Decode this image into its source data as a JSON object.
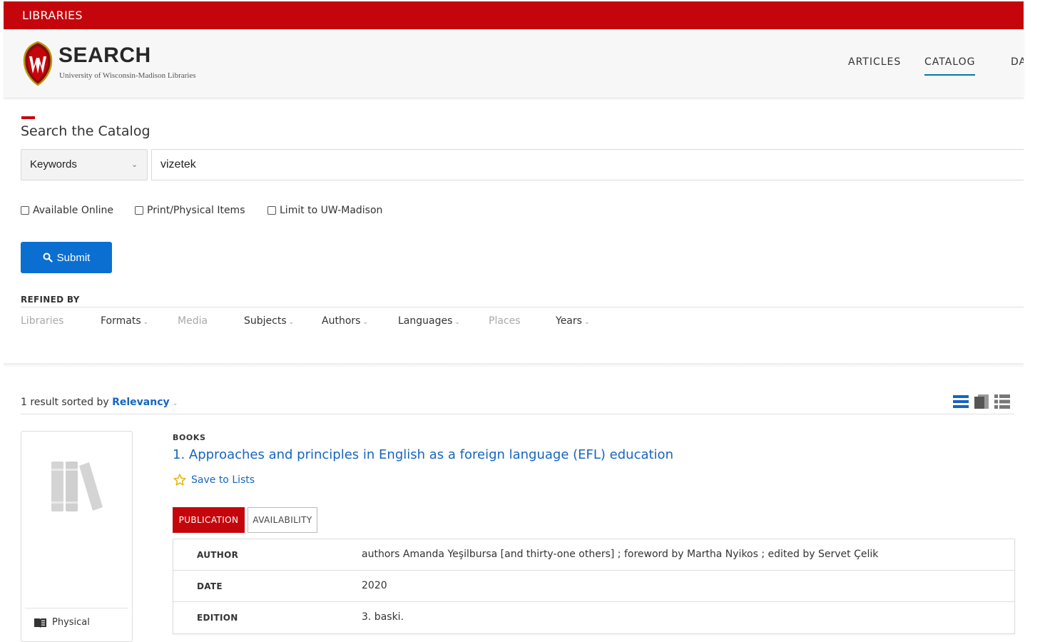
{
  "topbar": {
    "label": "LIBRARIES"
  },
  "brand": {
    "title": "SEARCH",
    "subtitle": "University of Wisconsin-Madison Libraries"
  },
  "nav": {
    "items": [
      "ARTICLES",
      "CATALOG",
      "DA"
    ],
    "active": "CATALOG"
  },
  "search": {
    "title": "Search the Catalog",
    "field_select": "Keywords",
    "query": "vizetek",
    "checkboxes": [
      "Available Online",
      "Print/Physical Items",
      "Limit to UW-Madison"
    ],
    "submit_label": "Submit"
  },
  "refined": {
    "heading": "REFINED BY",
    "facets": [
      {
        "label": "Libraries",
        "enabled": false
      },
      {
        "label": "Formats",
        "enabled": true
      },
      {
        "label": "Media",
        "enabled": false
      },
      {
        "label": "Subjects",
        "enabled": true
      },
      {
        "label": "Authors",
        "enabled": true
      },
      {
        "label": "Languages",
        "enabled": true
      },
      {
        "label": "Places",
        "enabled": false
      },
      {
        "label": "Years",
        "enabled": true
      }
    ]
  },
  "results": {
    "count_text": "1 result sorted by",
    "sort": "Relevancy"
  },
  "record": {
    "type": "BOOKS",
    "title": "1. Approaches and principles in English as a foreign language (EFL) education",
    "save_label": "Save to Lists",
    "format": "Physical",
    "tabs": [
      "PUBLICATION",
      "AVAILABILITY"
    ],
    "details": [
      {
        "label": "AUTHOR",
        "value": "authors Amanda Yeşilbursa [and thirty-one others] ; foreword by Martha Nyikos ; edited by Servet Çelik"
      },
      {
        "label": "DATE",
        "value": "2020"
      },
      {
        "label": "EDITION",
        "value": "3. baski."
      }
    ]
  },
  "colors": {
    "brand_red": "#c5050c",
    "link_blue": "#1565c0",
    "submit_blue": "#0b6fd1",
    "accent_blue": "#0479a8"
  }
}
